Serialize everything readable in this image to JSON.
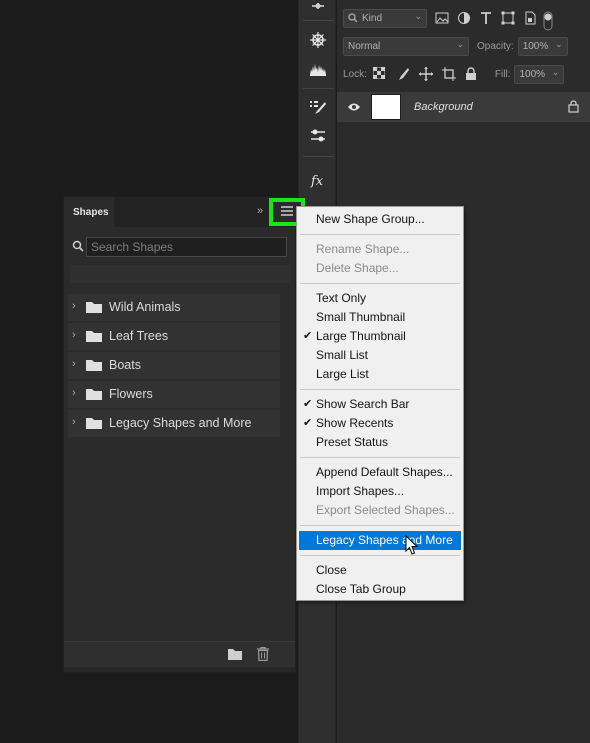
{
  "layers_panel": {
    "filter_kind": "Kind",
    "blend_mode": "Normal",
    "opacity_label": "Opacity:",
    "opacity_value": "100%",
    "lock_label": "Lock:",
    "fill_label": "Fill:",
    "fill_value": "100%",
    "layer_name": "Background"
  },
  "shapes_panel": {
    "tab_title": "Shapes",
    "search_placeholder": "Search Shapes",
    "groups": [
      {
        "label": "Wild Animals"
      },
      {
        "label": "Leaf Trees"
      },
      {
        "label": "Boats"
      },
      {
        "label": "Flowers"
      },
      {
        "label": "Legacy Shapes and More"
      }
    ]
  },
  "flyout_menu": {
    "items": [
      {
        "label": "New Shape Group...",
        "enabled": true,
        "checked": false
      },
      {
        "label": "Rename Shape...",
        "enabled": false,
        "checked": false
      },
      {
        "label": "Delete Shape...",
        "enabled": false,
        "checked": false
      },
      {
        "label": "Text Only",
        "enabled": true,
        "checked": false
      },
      {
        "label": "Small Thumbnail",
        "enabled": true,
        "checked": false
      },
      {
        "label": "Large Thumbnail",
        "enabled": true,
        "checked": true
      },
      {
        "label": "Small List",
        "enabled": true,
        "checked": false
      },
      {
        "label": "Large List",
        "enabled": true,
        "checked": false
      },
      {
        "label": "Show Search Bar",
        "enabled": true,
        "checked": true
      },
      {
        "label": "Show Recents",
        "enabled": true,
        "checked": true
      },
      {
        "label": "Preset Status",
        "enabled": true,
        "checked": false
      },
      {
        "label": "Append Default Shapes...",
        "enabled": true,
        "checked": false
      },
      {
        "label": "Import Shapes...",
        "enabled": true,
        "checked": false
      },
      {
        "label": "Export Selected Shapes...",
        "enabled": false,
        "checked": false
      },
      {
        "label": "Legacy Shapes and More",
        "enabled": true,
        "checked": false,
        "highlighted": true
      },
      {
        "label": "Close",
        "enabled": true,
        "checked": false
      },
      {
        "label": "Close Tab Group",
        "enabled": true,
        "checked": false
      }
    ],
    "check_glyph": "✔"
  },
  "colors": {
    "highlight": "#0078d7",
    "menu_button_outline": "#19e619",
    "panel_bg": "#2b2b2b"
  },
  "icons": {
    "tools": [
      "adjust-icon",
      "compass-icon",
      "histogram-icon",
      "brush-settings-icon",
      "properties-icon",
      "fx-icon"
    ],
    "shapes_footer": [
      "new-folder-icon",
      "trash-icon"
    ]
  }
}
